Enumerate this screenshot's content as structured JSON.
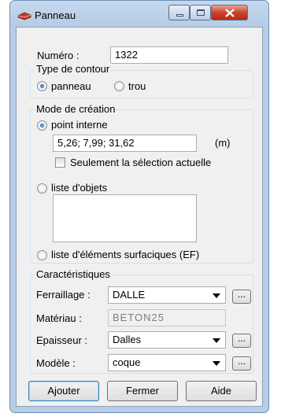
{
  "window": {
    "title": "Panneau",
    "icon": "beam-app-icon"
  },
  "numero": {
    "label": "Numéro :",
    "value": "1322"
  },
  "contour": {
    "legend": "Type de contour",
    "opt1": "panneau",
    "opt2": "trou",
    "selected": "panneau"
  },
  "creation": {
    "legend": "Mode de création",
    "opt_point": "point interne",
    "coords": "5,26; 7,99; 31,62",
    "unit": "(m)",
    "selection_only": "Seulement la sélection actuelle",
    "opt_list": "liste d'objets",
    "opt_ef": "liste d'éléments surfaciques (EF)",
    "selected": "point interne"
  },
  "carac": {
    "legend": "Caractéristiques",
    "ferraillage_label": "Ferraillage :",
    "ferraillage_value": "DALLE",
    "materiau_label": "Matériau :",
    "materiau_value": "BETON25",
    "epaisseur_label": "Epaisseur :",
    "epaisseur_value": "Dalles",
    "modele_label": "Modèle :",
    "modele_value": "coque",
    "browse": "..."
  },
  "buttons": {
    "add": "Ajouter",
    "close": "Fermer",
    "help": "Aide"
  }
}
